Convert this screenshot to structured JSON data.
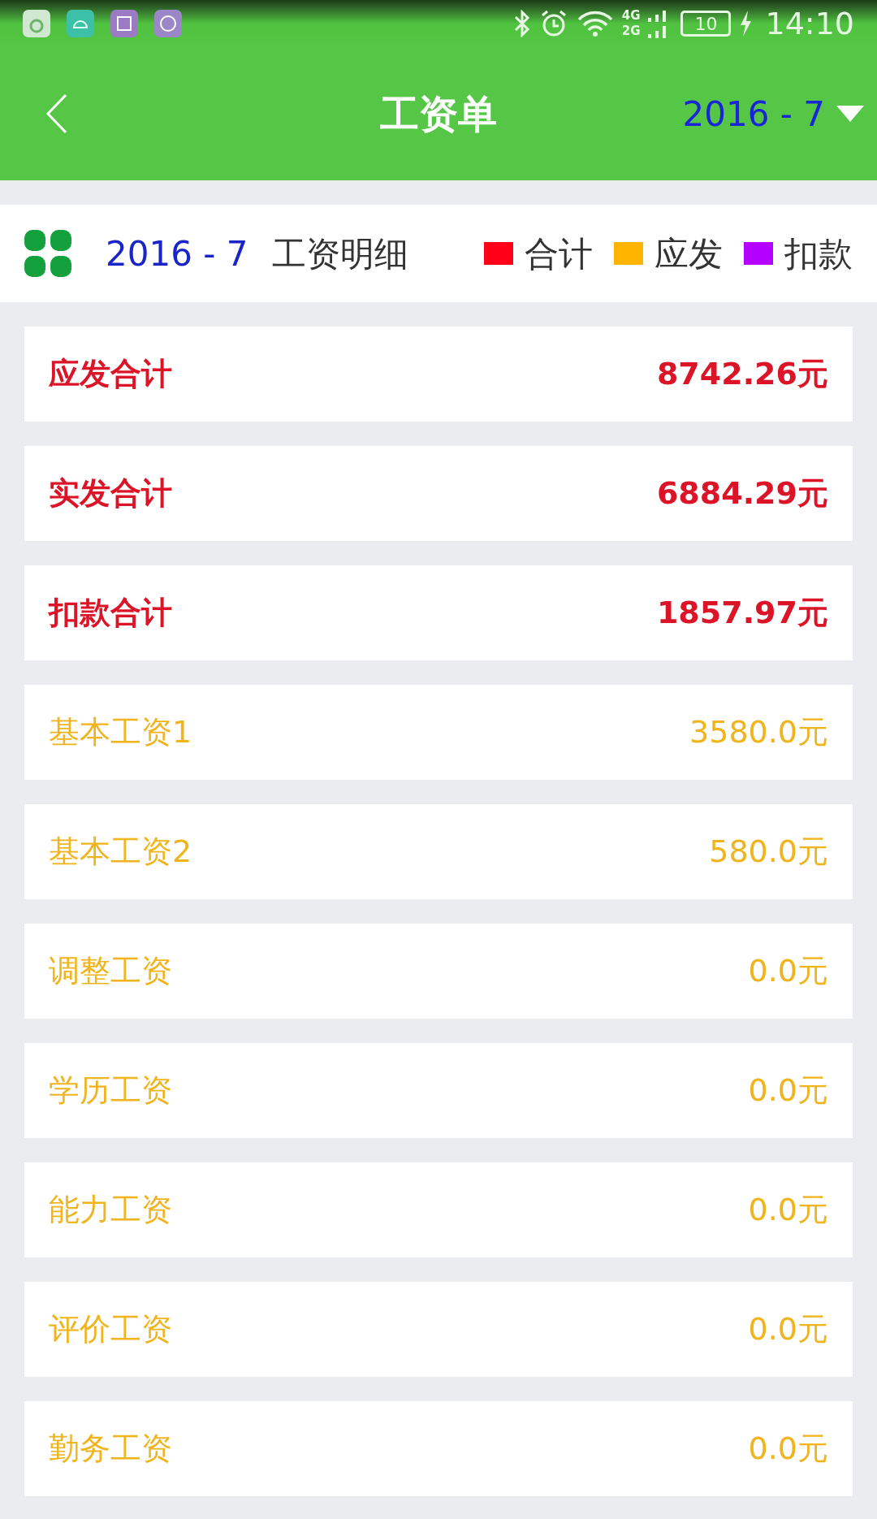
{
  "status_bar": {
    "time": "14:10",
    "battery": "10",
    "network_top": "4G",
    "network_bottom": "2G"
  },
  "header": {
    "title": "工资单",
    "period": "2016 - 7"
  },
  "summary": {
    "period": "2016 - 7",
    "title": "工资明细",
    "legend": [
      {
        "label": "合计",
        "color": "#ff0018"
      },
      {
        "label": "应发",
        "color": "#ffb400"
      },
      {
        "label": "扣款",
        "color": "#b400ff"
      }
    ]
  },
  "rows": [
    {
      "kind": "total",
      "label": "应发合计",
      "value": "8742.26元"
    },
    {
      "kind": "total",
      "label": "实发合计",
      "value": "6884.29元"
    },
    {
      "kind": "total",
      "label": "扣款合计",
      "value": "1857.97元"
    },
    {
      "kind": "earning",
      "label": "基本工资1",
      "value": "3580.0元"
    },
    {
      "kind": "earning",
      "label": "基本工资2",
      "value": "580.0元"
    },
    {
      "kind": "earning",
      "label": "调整工资",
      "value": "0.0元"
    },
    {
      "kind": "earning",
      "label": "学历工资",
      "value": "0.0元"
    },
    {
      "kind": "earning",
      "label": "能力工资",
      "value": "0.0元"
    },
    {
      "kind": "earning",
      "label": "评价工资",
      "value": "0.0元"
    },
    {
      "kind": "earning",
      "label": "勤务工资",
      "value": "0.0元"
    }
  ]
}
